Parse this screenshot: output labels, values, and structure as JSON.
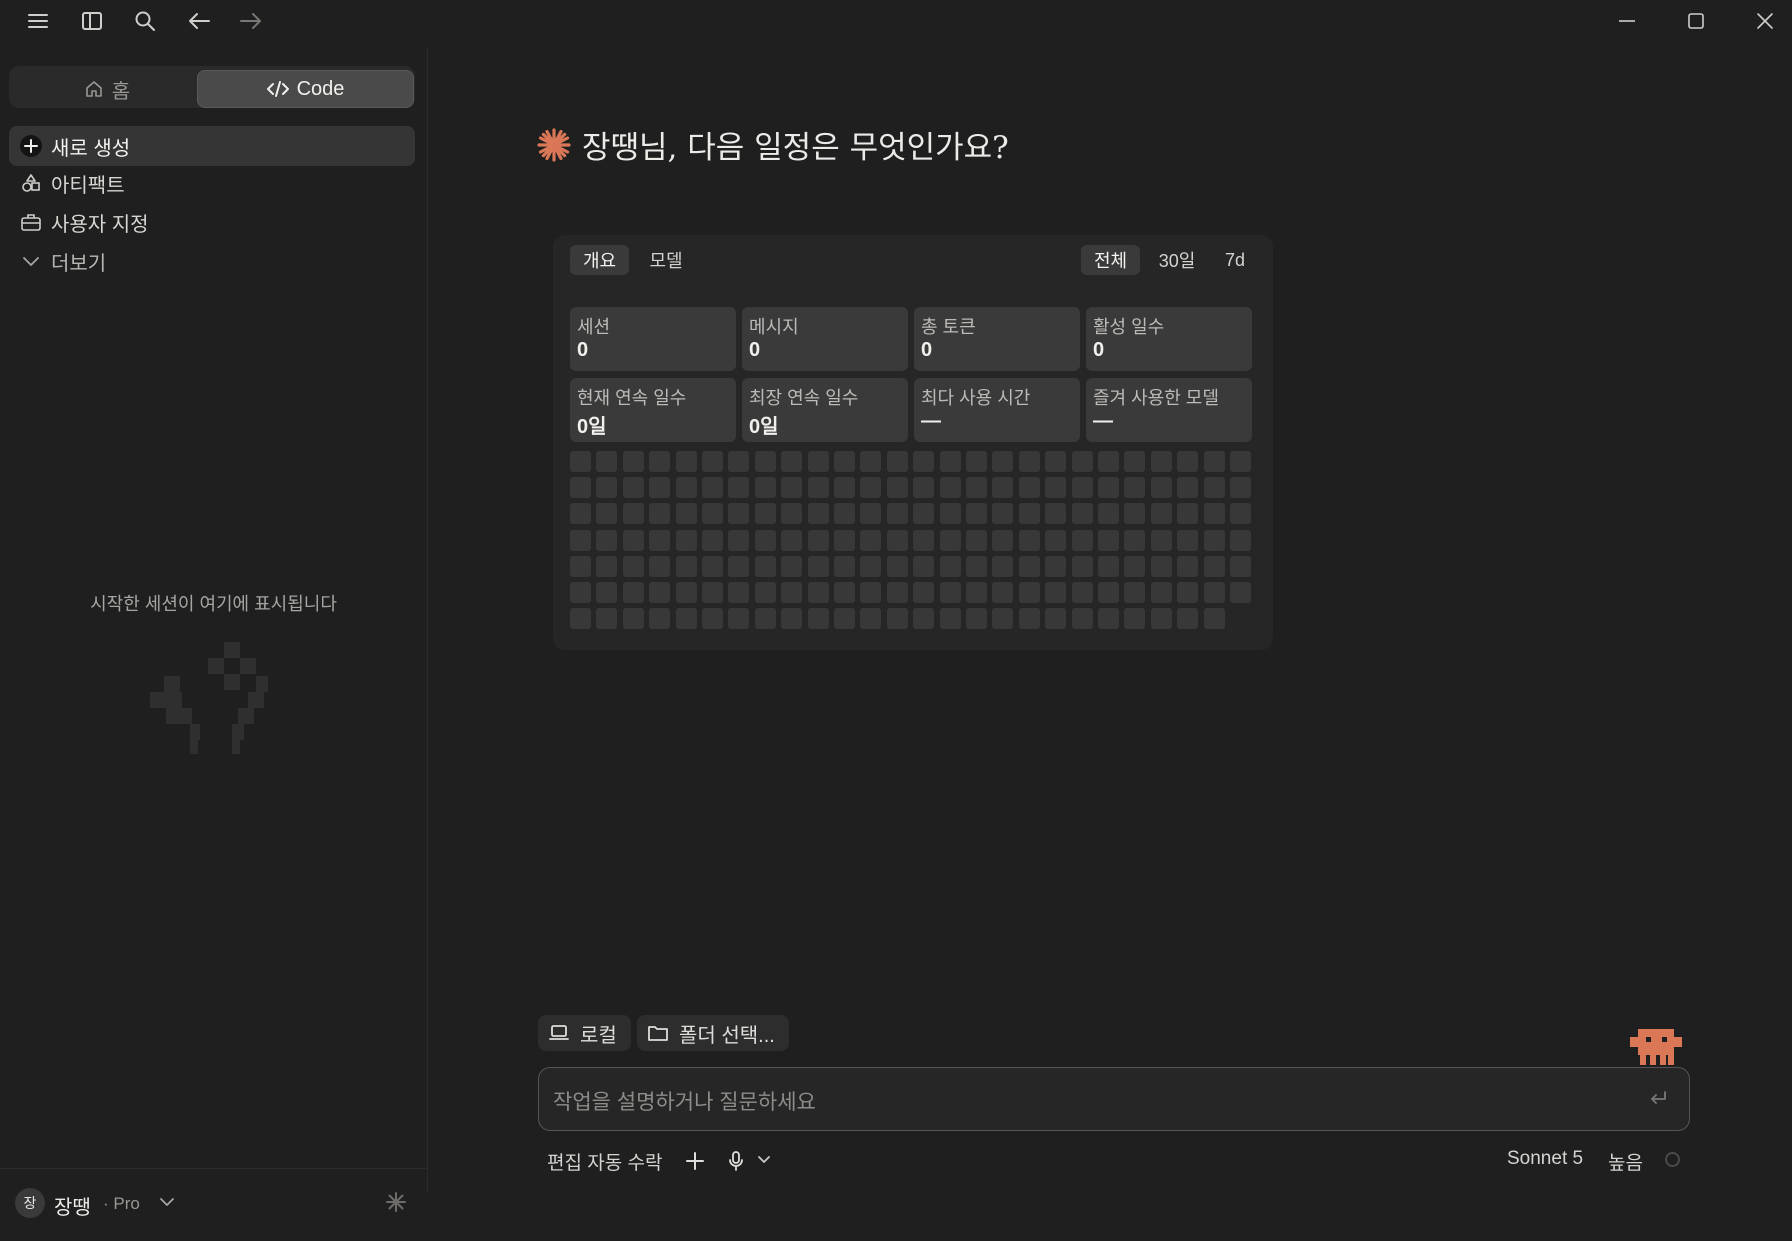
{
  "colors": {
    "accent": "#d97757",
    "background": "#1f1f1f",
    "card": "#262626",
    "cell": "#383838"
  },
  "titlebar": {
    "icons": [
      "menu-icon",
      "sidebar-toggle-icon",
      "search-icon",
      "back-arrow-icon",
      "forward-arrow-icon"
    ],
    "window_controls": [
      "minimize-icon",
      "maximize-icon",
      "close-icon"
    ]
  },
  "sidebar": {
    "mode_home": "홈",
    "mode_code": "Code",
    "items": [
      {
        "label": "새로 생성",
        "icon": "plus-icon"
      },
      {
        "label": "아티팩트",
        "icon": "artifacts-icon"
      },
      {
        "label": "사용자 지정",
        "icon": "briefcase-icon"
      },
      {
        "label": "더보기",
        "icon": "chevron-down-icon"
      }
    ],
    "empty_text": "시작한 세션이 여기에 표시됩니다",
    "user": {
      "avatar": "장",
      "name": "장땡",
      "plan": "· Pro"
    }
  },
  "main": {
    "greeting": "장땡님, 다음 일정은 무엇인가요?",
    "stats": {
      "tabs": [
        "개요",
        "모델"
      ],
      "ranges": [
        "전체",
        "30일",
        "7d"
      ],
      "cards": [
        {
          "label": "세션",
          "value": "0"
        },
        {
          "label": "메시지",
          "value": "0"
        },
        {
          "label": "총 토큰",
          "value": "0"
        },
        {
          "label": "활성 일수",
          "value": "0"
        },
        {
          "label": "현재 연속 일수",
          "value": "0일"
        },
        {
          "label": "최장 연속 일수",
          "value": "0일"
        },
        {
          "label": "최다 사용 시간",
          "value": "—"
        },
        {
          "label": "즐겨 사용한 모델",
          "value": "—"
        }
      ]
    },
    "chips": {
      "local": "로컬",
      "folder": "폴더 선택..."
    },
    "composer": {
      "placeholder": "작업을 설명하거나 질문하세요"
    },
    "bottom": {
      "auto_accept": "편집 자동 수락",
      "model": "Sonnet 5",
      "effort": "높음"
    }
  }
}
